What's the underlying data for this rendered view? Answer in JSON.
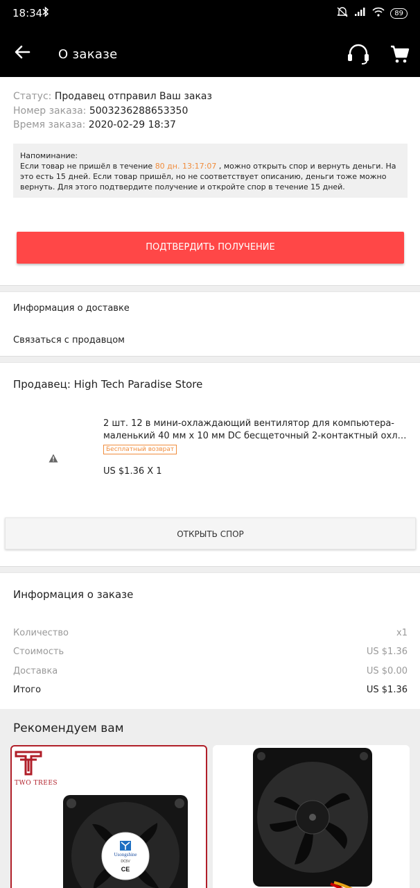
{
  "status_bar": {
    "time": "18:34",
    "battery": "89"
  },
  "header": {
    "title": "О заказе"
  },
  "order": {
    "status_label": "Статус:",
    "status_value": "Продавец отправил Ваш заказ",
    "number_label": "Номер заказа:",
    "number_value": "5003236288653350",
    "time_label": "Время заказа:",
    "time_value": "2020-02-29 18:37"
  },
  "reminder": {
    "title": "Напоминание:",
    "text_before": "Если товар не пришёл в течение ",
    "timer": "80 дн. 13:17:07",
    "text_after": " , можно открыть спор и вернуть деньги. На это есть 15 дней.    Если товар пришёл, но не соответствует описанию, деньги тоже можно вернуть. Для этого подтвердите получение и откройте спор в течение 15 дней."
  },
  "confirm_button": "ПОДТВЕРДИТЬ ПОЛУЧЕНИЕ",
  "links": {
    "delivery_info": "Информация о доставке",
    "contact_seller": "Связаться с продавцом"
  },
  "seller": {
    "name": "Продавец: High Tech Paradise Store"
  },
  "product": {
    "title_line1": "2 шт. 12 в мини-охлаждающий вентилятор для компьютера-",
    "title_line2": "маленький 40 мм x 10 мм DC бесщеточный 2-контактный охлада...",
    "badge": "Бесплатный возврат",
    "price": "US $1.36 X 1"
  },
  "dispute_button": "ОТКРЫТЬ СПОР",
  "order_info": {
    "title": "Информация о заказе",
    "rows": [
      {
        "label": "Количество",
        "value": "x1"
      },
      {
        "label": "Стоимость",
        "value": "US $1.36"
      },
      {
        "label": "Доставка",
        "value": "US $0.00"
      },
      {
        "label": "Итого",
        "value": "US $1.36"
      }
    ]
  },
  "recommend": {
    "title": "Рекомендуем вам",
    "card1_brand": "TWO TREES",
    "card1_sticker_brand": "Usongshine",
    "card1_sticker_model": "DC5V",
    "card1_sticker_mark": "CE"
  },
  "colors": {
    "accent_red": "#ff4747",
    "timer_orange": "#f08c3c",
    "brand_red": "#b01e28"
  },
  "icons": [
    "back-arrow-icon",
    "headset-icon",
    "cart-icon",
    "warning-icon",
    "bluetooth-icon",
    "mute-icon",
    "signal-icon",
    "wifi-icon"
  ]
}
